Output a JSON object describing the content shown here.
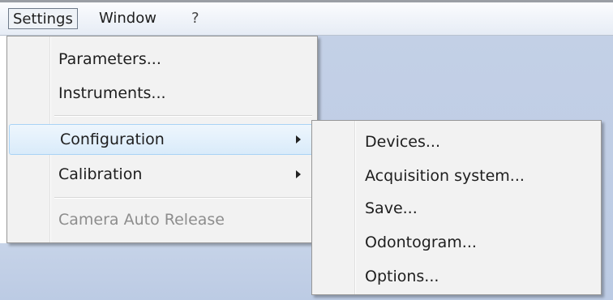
{
  "menubar": {
    "items": [
      {
        "label": "Settings"
      },
      {
        "label": "Window"
      },
      {
        "label": "?"
      }
    ]
  },
  "settings_menu": {
    "items": [
      {
        "label": "Parameters..."
      },
      {
        "label": "Instruments..."
      },
      {
        "label": "Configuration",
        "has_submenu": true,
        "highlighted": true
      },
      {
        "label": "Calibration",
        "has_submenu": true
      },
      {
        "label": "Camera Auto Release",
        "disabled": true
      }
    ]
  },
  "configuration_submenu": {
    "items": [
      {
        "label": "Devices..."
      },
      {
        "label": "Acquisition system..."
      },
      {
        "label": "Save..."
      },
      {
        "label": "Odontogram..."
      },
      {
        "label": "Options..."
      }
    ]
  },
  "colors": {
    "menu_background": "#f2f2f2",
    "highlight": "#d9ebfa",
    "highlight_border": "#a9d3f5",
    "app_background": "#bccbe4",
    "disabled_text": "#8d8d8d"
  }
}
